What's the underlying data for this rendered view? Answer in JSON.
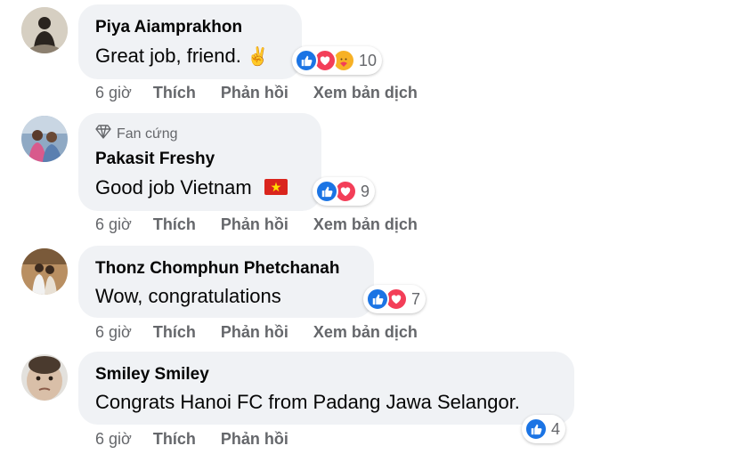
{
  "colors": {
    "like_blue": "#1b74e4",
    "love_red": "#f33e58",
    "care_yellow": "#f7b125",
    "bubble_bg": "#f0f2f5",
    "meta_gray": "#65676b"
  },
  "comments": [
    {
      "author": "Piya Aiamprakhon",
      "text": "Great job, friend.",
      "emoji": "✌️",
      "reactions": [
        "like-icon",
        "love-icon",
        "care-icon"
      ],
      "reaction_count": "10",
      "time": "6 giờ",
      "actions": [
        "Thích",
        "Phản hồi",
        "Xem bản dịch"
      ]
    },
    {
      "badge": "Fan cứng",
      "author": "Pakasit Freshy",
      "text": "Good job Vietnam",
      "emoji": "🇻🇳",
      "reactions": [
        "like-icon",
        "love-icon"
      ],
      "reaction_count": "9",
      "time": "6 giờ",
      "actions": [
        "Thích",
        "Phản hồi",
        "Xem bản dịch"
      ]
    },
    {
      "author": "Thonz Chomphun Phetchanah",
      "text": "Wow, congratulations",
      "reactions": [
        "like-icon",
        "love-icon"
      ],
      "reaction_count": "7",
      "time": "6 giờ",
      "actions": [
        "Thích",
        "Phản hồi",
        "Xem bản dịch"
      ]
    },
    {
      "author": "Smiley Smiley",
      "text": "Congrats Hanoi FC from Padang Jawa Selangor.",
      "reactions": [
        "like-icon"
      ],
      "reaction_count": "4",
      "time": "6 giờ",
      "actions": [
        "Thích",
        "Phản hồi"
      ]
    }
  ]
}
